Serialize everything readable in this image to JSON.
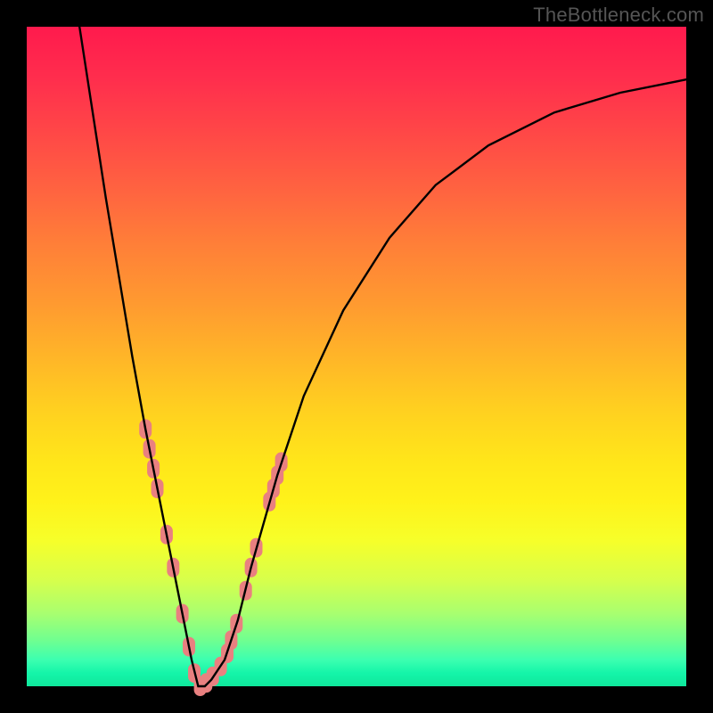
{
  "attribution": "TheBottleneck.com",
  "chart_data": {
    "type": "line",
    "title": "",
    "xlabel": "",
    "ylabel": "",
    "xlim": [
      0,
      100
    ],
    "ylim": [
      0,
      100
    ],
    "grid": false,
    "legend": false,
    "series": [
      {
        "name": "bottleneck-curve",
        "color": "#000000",
        "x": [
          8,
          10,
          12,
          14,
          16,
          18,
          20,
          22,
          23,
          24,
          25,
          26,
          27,
          28,
          30,
          32,
          34,
          38,
          42,
          48,
          55,
          62,
          70,
          80,
          90,
          100
        ],
        "values": [
          100,
          87,
          74,
          62,
          50,
          39,
          29,
          19,
          14,
          9,
          4,
          0,
          0,
          1,
          4,
          10,
          18,
          32,
          44,
          57,
          68,
          76,
          82,
          87,
          90,
          92
        ]
      }
    ],
    "markers": [
      {
        "name": "highlight-dots",
        "color": "#e98080",
        "shape": "rounded",
        "points": [
          {
            "x": 18.0,
            "y": 39.0
          },
          {
            "x": 18.6,
            "y": 36.0
          },
          {
            "x": 19.2,
            "y": 33.0
          },
          {
            "x": 19.8,
            "y": 30.0
          },
          {
            "x": 21.2,
            "y": 23.0
          },
          {
            "x": 22.2,
            "y": 18.0
          },
          {
            "x": 23.6,
            "y": 11.0
          },
          {
            "x": 24.6,
            "y": 6.0
          },
          {
            "x": 25.4,
            "y": 2.0
          },
          {
            "x": 26.3,
            "y": 0.0
          },
          {
            "x": 27.2,
            "y": 0.5
          },
          {
            "x": 28.2,
            "y": 1.5
          },
          {
            "x": 29.4,
            "y": 3.0
          },
          {
            "x": 30.4,
            "y": 5.0
          },
          {
            "x": 31.0,
            "y": 7.0
          },
          {
            "x": 31.8,
            "y": 9.5
          },
          {
            "x": 33.2,
            "y": 14.5
          },
          {
            "x": 34.0,
            "y": 18.0
          },
          {
            "x": 34.8,
            "y": 21.0
          },
          {
            "x": 36.8,
            "y": 28.0
          },
          {
            "x": 37.4,
            "y": 30.0
          },
          {
            "x": 38.0,
            "y": 32.0
          },
          {
            "x": 38.6,
            "y": 34.0
          }
        ]
      }
    ]
  }
}
